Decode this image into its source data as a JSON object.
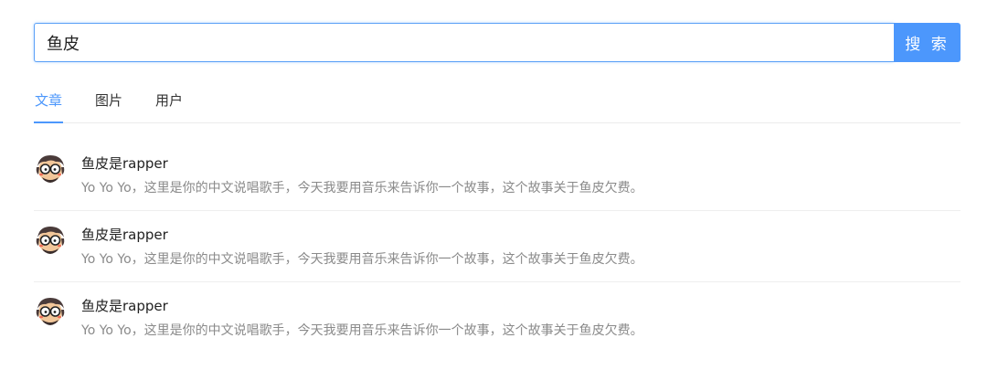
{
  "search": {
    "value": "鱼皮",
    "button_label": "搜 索"
  },
  "tabs": [
    {
      "label": "文章",
      "active": true
    },
    {
      "label": "图片",
      "active": false
    },
    {
      "label": "用户",
      "active": false
    }
  ],
  "results": [
    {
      "title": "鱼皮是rapper",
      "description": "Yo Yo Yo，这里是你的中文说唱歌手，今天我要用音乐来告诉你一个故事，这个故事关于鱼皮欠费。",
      "avatar_icon": "cartoon-avatar-icon"
    },
    {
      "title": "鱼皮是rapper",
      "description": "Yo Yo Yo，这里是你的中文说唱歌手，今天我要用音乐来告诉你一个故事，这个故事关于鱼皮欠费。",
      "avatar_icon": "cartoon-avatar-icon"
    },
    {
      "title": "鱼皮是rapper",
      "description": "Yo Yo Yo，这里是你的中文说唱歌手，今天我要用音乐来告诉你一个故事，这个故事关于鱼皮欠费。",
      "avatar_icon": "cartoon-avatar-icon"
    }
  ],
  "colors": {
    "accent": "#4c97fc",
    "input_border": "#5aa0f7",
    "description_text": "#8a8a8a",
    "divider": "#eeeeee"
  }
}
